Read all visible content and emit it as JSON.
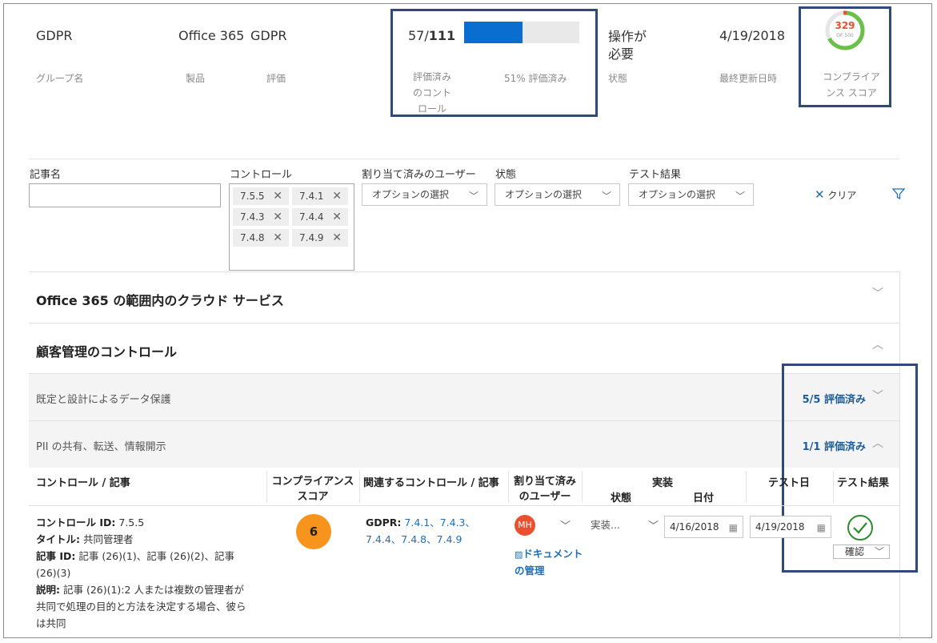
{
  "header": {
    "group_name": {
      "value": "GDPR",
      "label": "グループ名"
    },
    "product": {
      "value": "Office 365",
      "label": "製品"
    },
    "assessment": {
      "value": "GDPR",
      "label": "評価"
    },
    "assessed": {
      "done": "57",
      "total": "111",
      "sep": "/",
      "label_lines": [
        "評価済み",
        "のコント",
        "ロール"
      ],
      "percent_text": "51% 評価済み",
      "progress_fraction": 0.51,
      "bar_color": "#0a6ed1",
      "track_color": "#e9e9e9"
    },
    "status": {
      "value_lines": [
        "操作が",
        "必要"
      ],
      "label": "状態"
    },
    "last_updated": {
      "value": "4/19/2018",
      "label": "最終更新日時"
    },
    "compliance_score": {
      "value": "329",
      "sub": "OF 500",
      "label_lines": [
        "コンプライア",
        "ンス スコア"
      ],
      "ring_color_main": "#6cc04a",
      "ring_color_accent": "#e8502f"
    }
  },
  "filters": {
    "article_name": {
      "label": "記事名",
      "value": ""
    },
    "control": {
      "label": "コントロール",
      "chips": [
        "7.5.5",
        "7.4.1",
        "7.4.3",
        "7.4.4",
        "7.4.8",
        "7.4.9"
      ]
    },
    "assigned_user": {
      "label": "割り当て済みのユーザー",
      "selected": "オプションの選択"
    },
    "state": {
      "label": "状態",
      "selected": "オプションの選択"
    },
    "test_result": {
      "label": "テスト結果",
      "selected": "オプションの選択"
    },
    "clear_label": "クリア"
  },
  "sections": [
    {
      "title": "Office 365 の範囲内のクラウド サービス"
    },
    {
      "title": "顧客管理のコントロール"
    }
  ],
  "subsections": [
    {
      "title": "既定と設計によるデータ保護",
      "status": "5/5 評価済み"
    },
    {
      "title": "PII の共有、転送、情報開示",
      "status": "1/1 評価済み"
    }
  ],
  "table": {
    "headers": {
      "control_article": "コントロール / 記事",
      "compliance_score_l1": "コンプライアンス",
      "compliance_score_l2": "スコア",
      "related": "関連するコントロール / 記事",
      "assigned_l1": "割り当て済み",
      "assigned_l2": "のユーザー",
      "impl": "実装",
      "impl_state": "状態",
      "impl_date": "日付",
      "test_date": "テスト日",
      "test_result": "テスト結果"
    },
    "row": {
      "control_id_label": "コントロール ID:",
      "control_id": " 7.5.5",
      "title_label": "タイトル:",
      "title": " 共同管理者",
      "article_id_label": "記事 ID:",
      "article_id_lines": [
        " 記事 (26)(1)、記事 (26)(2)、記事",
        "(26)(3)"
      ],
      "desc_label": "説明:",
      "desc_lines": [
        " 記事 (26)(1):2 人または複数の管理者が",
        "共同で処理の目的と方法を決定する場合、彼ら",
        "は共同"
      ],
      "score": "6",
      "score_color": "#f7941d",
      "related_label": "GDPR:",
      "related_line1": " 7.4.1、7.4.3、",
      "related_line2": "7.4.4、7.4.8、7.4.9",
      "user_initials": "MH",
      "avatar_color": "#e8502f",
      "manage_docs_l1": "ドキュメント",
      "manage_docs_l2": "の管理",
      "impl_state": "実装...",
      "impl_date": "4/16/2018",
      "test_date": "4/19/2018",
      "test_result": "確認",
      "pass_color": "#2e8b2e"
    }
  }
}
